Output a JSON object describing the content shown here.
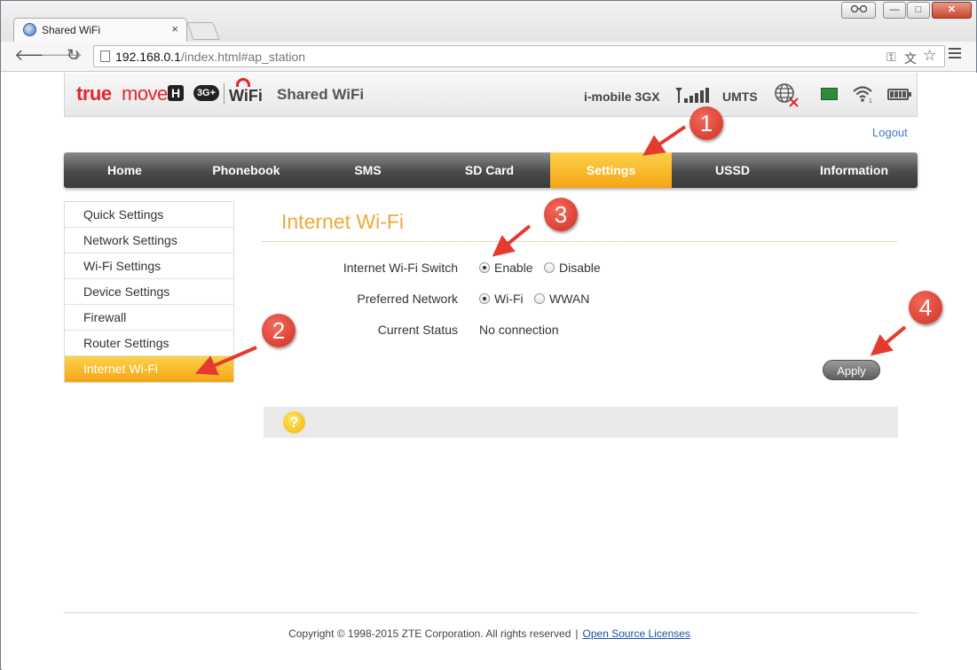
{
  "browser": {
    "tab_title": "Shared WiFi",
    "tab_close": "×",
    "url_host": "192.168.0.1",
    "url_path": "/index.html#ap_station",
    "win_min": "—",
    "win_max": "□",
    "win_close": "✕"
  },
  "header": {
    "logo_true": "true",
    "logo_move": "move",
    "logo_h": "H",
    "logo_3g": "3G+",
    "logo_wifi": "WiFi",
    "title": "Shared WiFi",
    "operator": "i-mobile 3GX",
    "network_type": "UMTS",
    "logout": "Logout"
  },
  "nav": {
    "items": [
      "Home",
      "Phonebook",
      "SMS",
      "SD Card",
      "Settings",
      "USSD",
      "Information"
    ],
    "active": "Settings"
  },
  "sidebar": {
    "items": [
      "Quick Settings",
      "Network Settings",
      "Wi-Fi Settings",
      "Device Settings",
      "Firewall",
      "Router Settings",
      "Internet Wi-Fi"
    ],
    "active": "Internet Wi-Fi"
  },
  "content": {
    "title": "Internet Wi-Fi",
    "switch_label": "Internet Wi-Fi Switch",
    "switch_options": [
      "Enable",
      "Disable"
    ],
    "switch_selected": "Enable",
    "network_label": "Preferred Network",
    "network_options": [
      "Wi-Fi",
      "WWAN"
    ],
    "network_selected": "Wi-Fi",
    "status_label": "Current Status",
    "status_value": "No connection",
    "apply": "Apply",
    "help": "?"
  },
  "footer": {
    "copyright": "Copyright © 1998-2015 ZTE Corporation. All rights reserved",
    "separator": "|",
    "license_link": "Open Source Licenses"
  },
  "annotations": {
    "step_1": "1",
    "step_2": "2",
    "step_3": "3",
    "step_4": "4",
    "color": "#e53a2e"
  },
  "colors": {
    "accent": "#f5a516",
    "title": "#f0a83a",
    "link": "#3a7cc2"
  }
}
